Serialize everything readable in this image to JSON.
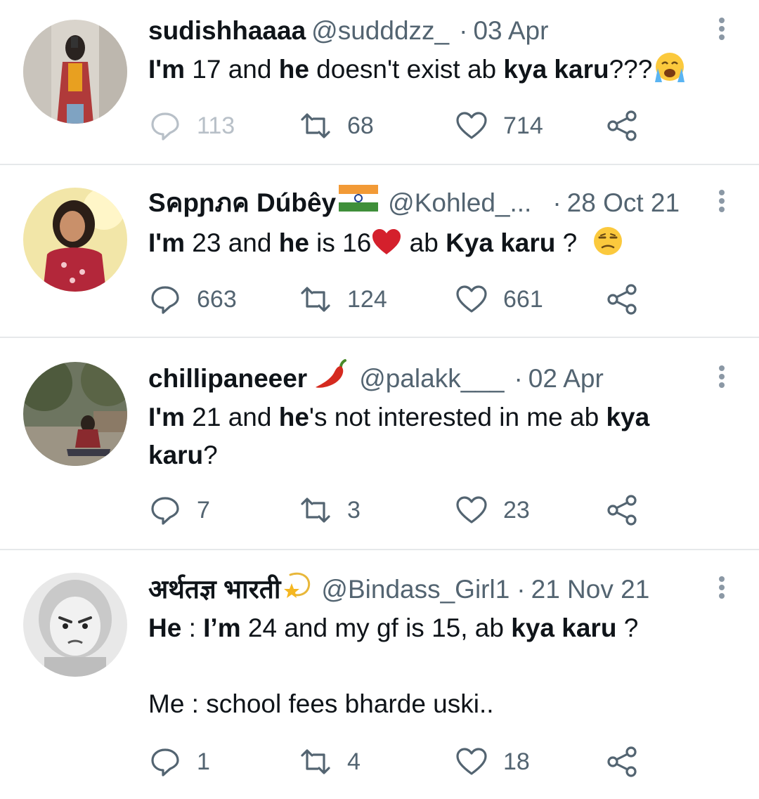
{
  "colors": {
    "text": "#0f1419",
    "secondary": "#536471",
    "divider": "#e6e8ea",
    "icon": "#536471"
  },
  "tweets": [
    {
      "name": "sudishhaaaa",
      "handle": "@sudddzz_",
      "dot": "·",
      "date": "03 Apr",
      "body": [
        [
          {
            "t": "I'm",
            "b": true
          },
          {
            "t": " 17 and ",
            "b": false
          },
          {
            "t": "he",
            "b": true
          },
          {
            "t": " doesn't exist ab ",
            "b": false
          },
          {
            "t": "kya karu",
            "b": true
          },
          {
            "t": "???",
            "b": false
          }
        ]
      ],
      "body_emoji": "crying-face-emoji",
      "replies": "113",
      "retweets": "68",
      "likes": "714"
    },
    {
      "name": "Sคрɲภค Dúbêy",
      "name_emoji": "india-flag-emoji",
      "handle": "@Kohled_...",
      "dot": "·",
      "date": "28 Oct 21",
      "body": [
        [
          {
            "t": "I'm",
            "b": true
          },
          {
            "t": " 23 and ",
            "b": false
          },
          {
            "t": "he",
            "b": true
          },
          {
            "t": " is 16",
            "b": false
          }
        ]
      ],
      "body_tail": [
        {
          "t": " ab ",
          "b": false
        },
        {
          "t": "Kya karu",
          "b": true
        },
        {
          "t": " ? ",
          "b": false
        }
      ],
      "body_emoji": "unamused-face-emoji",
      "replies": "663",
      "retweets": "124",
      "likes": "661"
    },
    {
      "name": "chillipaneeer",
      "name_emoji": "hot-pepper-emoji",
      "handle": "@palakk___",
      "dot": "·",
      "date": "02 Apr",
      "body": [
        [
          {
            "t": "I'm",
            "b": true
          },
          {
            "t": " 21 and ",
            "b": false
          },
          {
            "t": "he",
            "b": true
          },
          {
            "t": "'s not interested in me ab ",
            "b": false
          },
          {
            "t": "kya",
            "b": true
          }
        ],
        [
          {
            "t": "karu",
            "b": true
          },
          {
            "t": "?",
            "b": false
          }
        ]
      ],
      "replies": "7",
      "retweets": "3",
      "likes": "23"
    },
    {
      "name": "अर्थतज्ञ भारती",
      "name_emoji": "dizzy-star-emoji",
      "handle": "@Bindass_Girl1",
      "dot": "·",
      "date": "21 Nov 21",
      "body": [
        [
          {
            "t": "He",
            "b": true
          },
          {
            "t": " : ",
            "b": false
          },
          {
            "t": "I’m",
            "b": true
          },
          {
            "t": " 24 and my gf is 15, ab ",
            "b": false
          },
          {
            "t": "kya karu",
            "b": true
          },
          {
            "t": " ?",
            "b": false
          }
        ],
        [
          {
            "t": "",
            "b": false
          }
        ],
        [
          {
            "t": "Me : school fees bharde uski..",
            "b": false
          }
        ]
      ],
      "replies": "1",
      "retweets": "4",
      "likes": "18"
    }
  ]
}
